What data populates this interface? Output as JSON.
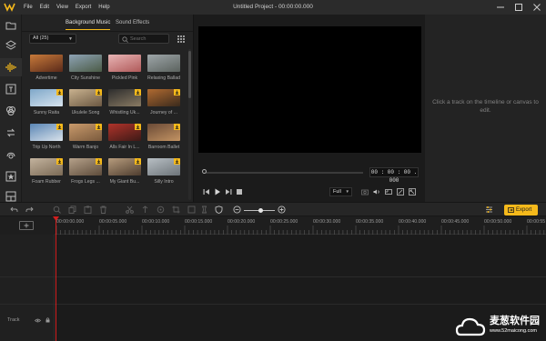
{
  "menu": [
    "File",
    "Edit",
    "View",
    "Export",
    "Help"
  ],
  "window_title": "Untitled Project - 00:00:00.000",
  "library": {
    "tabs": [
      "Background Music",
      "Sound Effects"
    ],
    "filter": "All (25)",
    "search_placeholder": "Search",
    "tracks": [
      {
        "label": "Advertime",
        "download": false
      },
      {
        "label": "City Sunshine",
        "download": false
      },
      {
        "label": "Pickled Pink",
        "download": false
      },
      {
        "label": "Relaxing Ballad",
        "download": false
      },
      {
        "label": "Sunny Raita",
        "download": true
      },
      {
        "label": "Ukulele Song",
        "download": true
      },
      {
        "label": "Whistling Uk...",
        "download": true
      },
      {
        "label": "Journey of ...",
        "download": true
      },
      {
        "label": "Trip Up North",
        "download": true
      },
      {
        "label": "Warm Banjo",
        "download": true
      },
      {
        "label": "Alls Fair In L...",
        "download": true
      },
      {
        "label": "Barroom Ballet",
        "download": true
      },
      {
        "label": "Foam Rubber",
        "download": true
      },
      {
        "label": "Frogs Legs ...",
        "download": true
      },
      {
        "label": "My Giant Bu...",
        "download": true
      },
      {
        "label": "Silly Intro",
        "download": true
      }
    ]
  },
  "preview": {
    "timecode": "00 : 00 : 00 . 000",
    "quality": "Full",
    "progress": 0
  },
  "properties": {
    "message": "Click a track on the timeline or canvas to edit."
  },
  "toolbar": {
    "export_label": "Export"
  },
  "ruler": [
    "00:00:00.000",
    "00:00:05.000",
    "00:00:10.000",
    "00:00:15.000",
    "00:00:20.000",
    "00:00:25.000",
    "00:00:30.000",
    "00:00:35.000",
    "00:00:40.000",
    "00:00:45.000",
    "00:00:50.000",
    "00:00:55"
  ],
  "timeline": {
    "track_name": "Track"
  },
  "watermark": {
    "brand": "麦葱软件园",
    "url": "www.52maicong.com"
  },
  "colors": {
    "accent": "#f5b91b",
    "playhead": "#d21f1f",
    "background": "#1e1e1e"
  }
}
